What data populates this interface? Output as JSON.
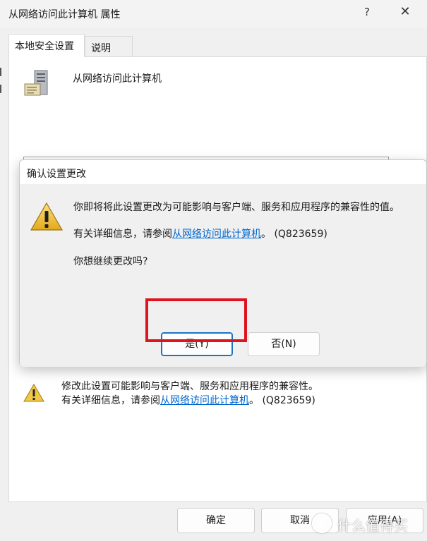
{
  "window": {
    "title": "从网络访问此计算机 属性",
    "help_glyph": "?",
    "close_glyph": "✕"
  },
  "tabs": [
    {
      "label": "本地安全设置",
      "active": true
    },
    {
      "label": "说明",
      "active": false
    }
  ],
  "policy": {
    "name": "从网络访问此计算机",
    "icon": "server-icon"
  },
  "warning_panel": {
    "line1": "修改此设置可能影响与客户端、服务和应用程序的兼容性。",
    "line2_prefix": "有关详细信息，请参阅",
    "link_text": "从网络访问此计算机",
    "line2_suffix": "。 (Q823659)"
  },
  "buttons": {
    "ok": "确定",
    "cancel": "取消",
    "apply": "应用(A)"
  },
  "dialog": {
    "title": "确认设置更改",
    "message1": "你即将将此设置更改为可能影响与客户端、服务和应用程序的兼容性的值。",
    "message2_prefix": "有关详细信息，请参阅",
    "message2_link": "从网络访问此计算机",
    "message2_suffix": "。 (Q823659)",
    "message3": "你想继续更改吗?",
    "yes_label": "是(Y)",
    "no_label": "否(N)",
    "highlight_color": "#e0141e"
  },
  "watermark": {
    "logo_glyph": "值",
    "text": "什么值得买"
  },
  "colors": {
    "link": "#0066cc",
    "focus_border": "#1a73c7"
  }
}
